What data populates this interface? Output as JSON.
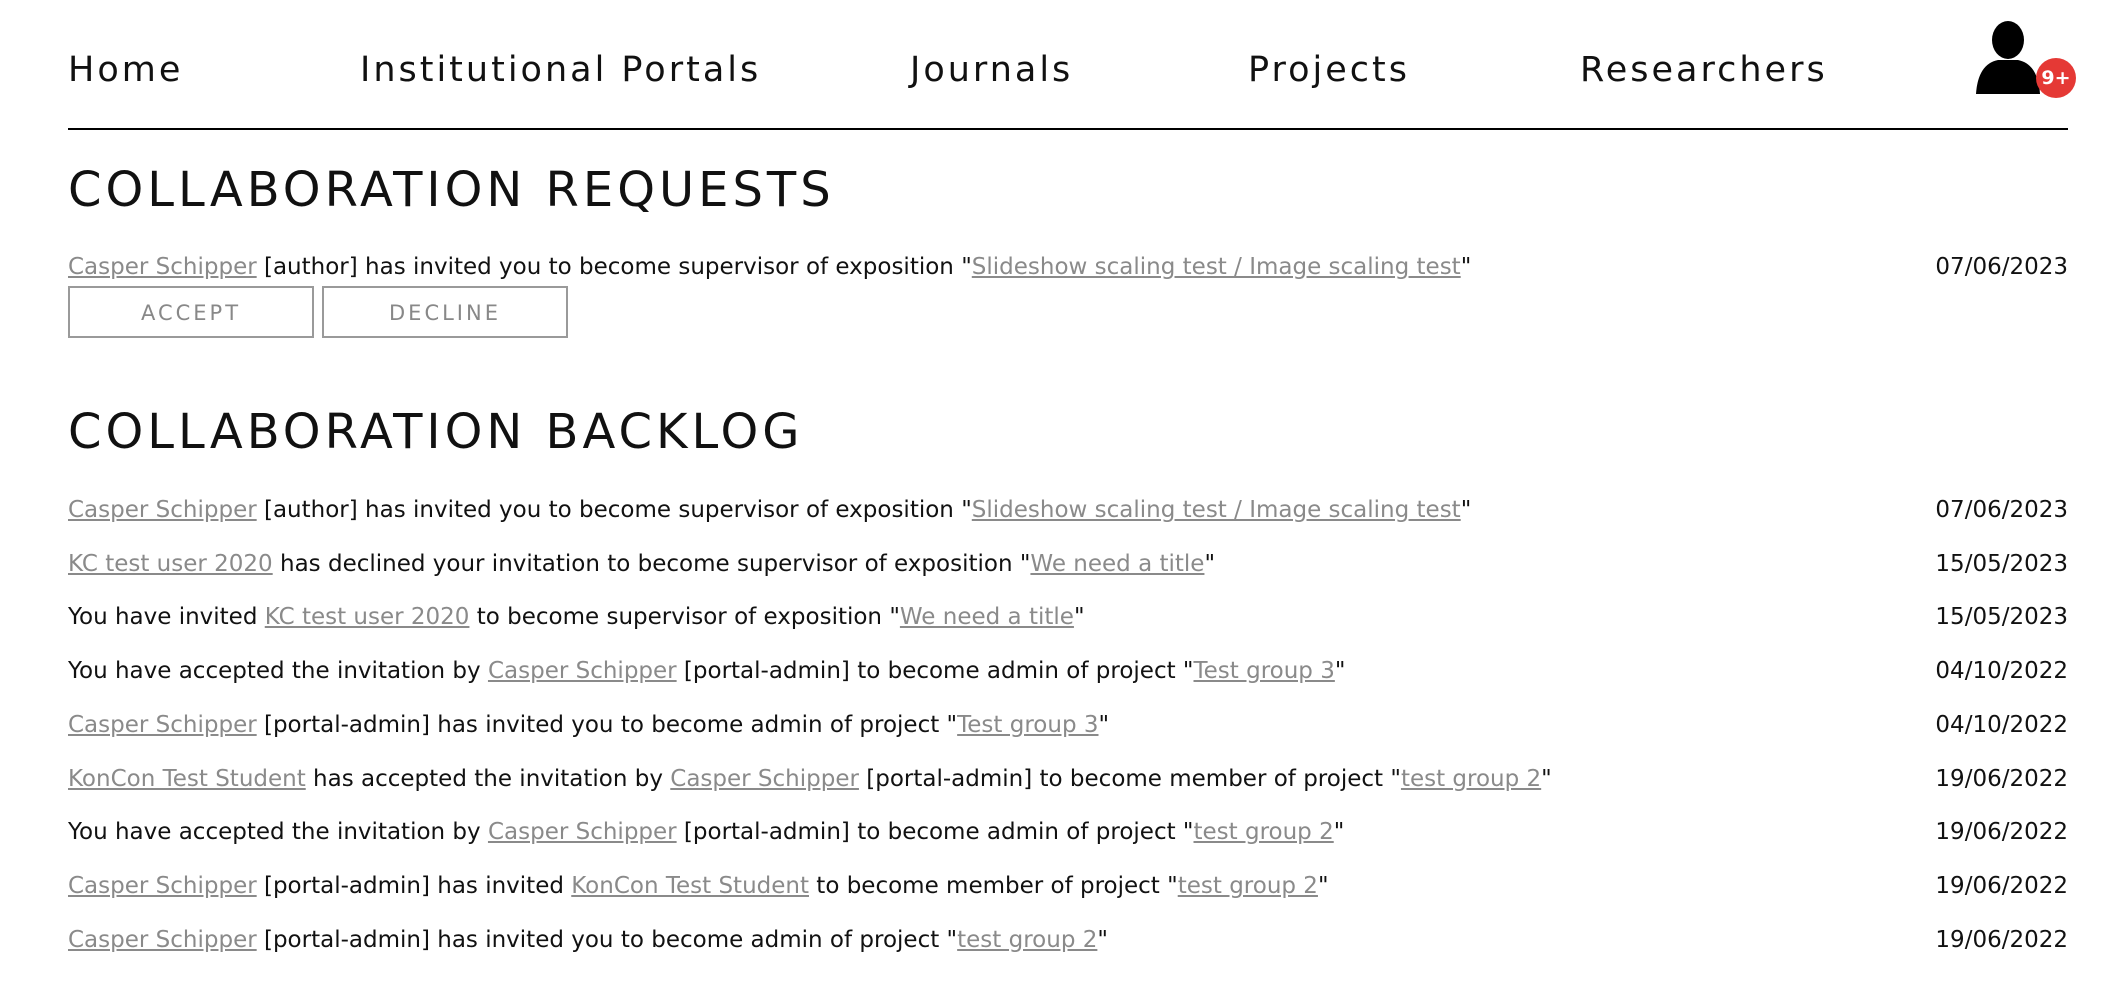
{
  "nav": {
    "items": [
      "Home",
      "Institutional Portals",
      "Journals",
      "Projects",
      "Researchers"
    ],
    "badge": "9+"
  },
  "requests": {
    "title": "COLLABORATION REQUESTS",
    "item": {
      "user": "Casper Schipper",
      "role": " [author] has invited you to become supervisor of exposition \"",
      "exposition": "Slideshow scaling test / Image scaling test",
      "end": "\"",
      "date": "07/06/2023"
    },
    "accept": "ACCEPT",
    "decline": "DECLINE"
  },
  "backlog": {
    "title": "COLLABORATION BACKLOG",
    "rows": [
      {
        "p": [
          {
            "l": "Casper Schipper"
          },
          {
            "t": " [author] has invited you to become supervisor of exposition \""
          },
          {
            "l": "Slideshow scaling test / Image scaling test"
          },
          {
            "t": "\""
          }
        ],
        "date": "07/06/2023"
      },
      {
        "p": [
          {
            "l": "KC test user 2020"
          },
          {
            "t": " has declined your invitation to become supervisor of exposition \""
          },
          {
            "l": "We need a title"
          },
          {
            "t": "\""
          }
        ],
        "date": "15/05/2023"
      },
      {
        "p": [
          {
            "t": "You have invited "
          },
          {
            "l": "KC test user 2020"
          },
          {
            "t": " to become supervisor of exposition \""
          },
          {
            "l": "We need a title"
          },
          {
            "t": "\""
          }
        ],
        "date": "15/05/2023"
      },
      {
        "p": [
          {
            "t": "You have accepted the invitation by "
          },
          {
            "l": "Casper Schipper"
          },
          {
            "t": " [portal-admin] to become admin of project \""
          },
          {
            "l": "Test group 3"
          },
          {
            "t": "\""
          }
        ],
        "date": "04/10/2022"
      },
      {
        "p": [
          {
            "l": "Casper Schipper"
          },
          {
            "t": " [portal-admin] has invited you to become admin of project \""
          },
          {
            "l": "Test group 3"
          },
          {
            "t": "\""
          }
        ],
        "date": "04/10/2022"
      },
      {
        "p": [
          {
            "l": "KonCon Test Student"
          },
          {
            "t": " has accepted the invitation by "
          },
          {
            "l": "Casper Schipper"
          },
          {
            "t": " [portal-admin] to become member of project \""
          },
          {
            "l": "test group 2"
          },
          {
            "t": "\""
          }
        ],
        "date": "19/06/2022"
      },
      {
        "p": [
          {
            "t": "You have accepted the invitation by "
          },
          {
            "l": "Casper Schipper"
          },
          {
            "t": " [portal-admin] to become admin of project \""
          },
          {
            "l": "test group 2"
          },
          {
            "t": "\""
          }
        ],
        "date": "19/06/2022"
      },
      {
        "p": [
          {
            "l": "Casper Schipper"
          },
          {
            "t": " [portal-admin] has invited "
          },
          {
            "l": "KonCon Test Student"
          },
          {
            "t": " to become member of project \""
          },
          {
            "l": "test group 2"
          },
          {
            "t": "\""
          }
        ],
        "date": "19/06/2022"
      },
      {
        "p": [
          {
            "l": "Casper Schipper"
          },
          {
            "t": " [portal-admin] has invited you to become admin of project \""
          },
          {
            "l": "test group 2"
          },
          {
            "t": "\""
          }
        ],
        "date": "19/06/2022"
      }
    ]
  }
}
